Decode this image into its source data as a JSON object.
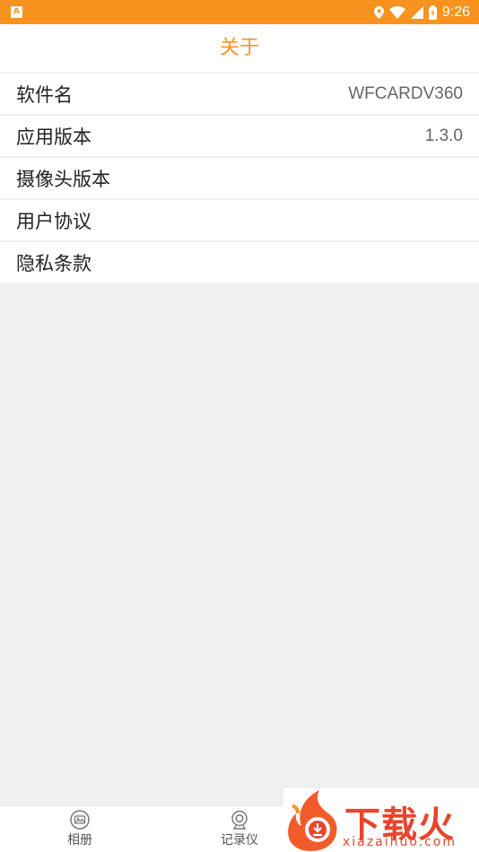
{
  "status_bar": {
    "notification_icon": "A",
    "time": "9:26",
    "icons": [
      "location-icon",
      "wifi-icon",
      "signal-icon",
      "battery-icon"
    ],
    "background": "#f7931e"
  },
  "header": {
    "title": "关于",
    "accent_color": "#f7931e"
  },
  "list": [
    {
      "label": "软件名",
      "value": "WFCARDV360"
    },
    {
      "label": "应用版本",
      "value": "1.3.0"
    },
    {
      "label": "摄像头版本",
      "value": ""
    },
    {
      "label": "用户协议",
      "value": ""
    },
    {
      "label": "隐私条款",
      "value": ""
    }
  ],
  "tabbar": {
    "tabs": [
      {
        "label": "相册",
        "icon": "album-icon"
      },
      {
        "label": "记录仪",
        "icon": "camera-icon"
      }
    ]
  },
  "watermark": {
    "text": "下载火",
    "sub": "xiazaihuo.com"
  }
}
